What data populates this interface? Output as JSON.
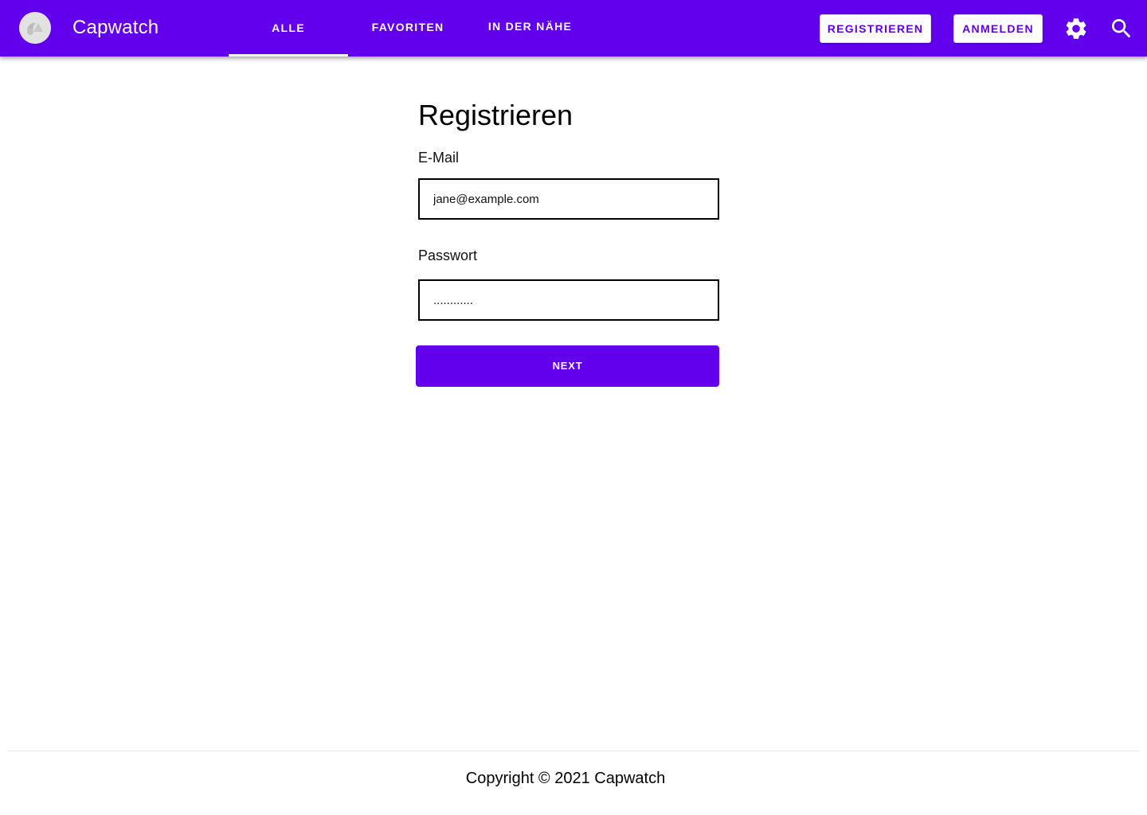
{
  "app": {
    "title": "Capwatch"
  },
  "tabs": [
    {
      "label": "ALLE",
      "active": true
    },
    {
      "label": "FAVORITEN",
      "active": false
    },
    {
      "label": "IN DER NÄHE",
      "active": false
    }
  ],
  "toolbar": {
    "register_label": "REGISTRIEREN",
    "login_label": "ANMELDEN",
    "settings_icon": "gear-icon",
    "search_icon": "search-icon"
  },
  "form": {
    "heading": "Registrieren",
    "email_label": "E-Mail",
    "email_value": "jane@example.com",
    "password_label": "Passwort",
    "password_value": "............",
    "next_label": "NEXT"
  },
  "footer": {
    "copyright": "Copyright © 2021 Capwatch"
  },
  "colors": {
    "primary": "#6200ee",
    "on_primary": "#ffffff",
    "tab_indicator": "#f2f2f2"
  }
}
